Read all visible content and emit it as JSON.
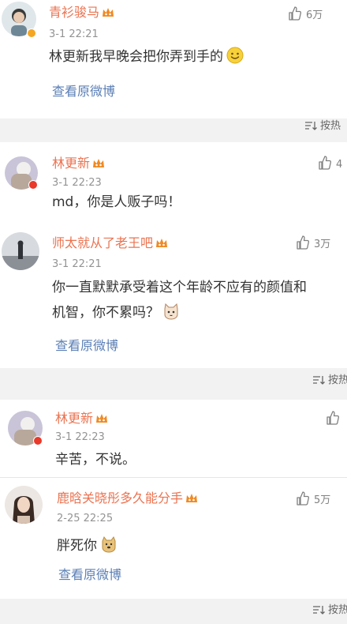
{
  "comments": [
    {
      "name": "青衫骏马",
      "time": "3-1 22:21",
      "likes": "6万",
      "text": "林更新我早晚会把你弄到手的",
      "link": "查看原微博",
      "avatar_icon": "user-avatar-icon",
      "badge_icon": "verified-badge-icon"
    },
    {
      "name": "林更新",
      "time": "3-1 22:23",
      "likes": "4",
      "text": "md，你是人贩子吗！",
      "avatar_icon": "user-avatar-icon",
      "badge_icon": "verified-badge-icon"
    },
    {
      "name": "师太就从了老王吧",
      "time": "3-1 22:21",
      "likes": "3万",
      "text_line1": "你一直默默承受着这个年龄不应有的颜值和",
      "text_line2": "机智，你不累吗？",
      "link": "查看原微博",
      "avatar_icon": "user-avatar-icon"
    },
    {
      "name": "林更新",
      "time": "3-1 22:23",
      "text": "辛苦，不说。",
      "avatar_icon": "user-avatar-icon",
      "badge_icon": "verified-badge-icon"
    },
    {
      "name": "鹿晗关晓彤多久能分手",
      "time": "2-25 22:25",
      "likes": "5万",
      "text": "胖死你",
      "link": "查看原微博",
      "avatar_icon": "user-avatar-icon"
    }
  ],
  "sort_label": "按热",
  "sort_label_2": "按热",
  "sort_label_3": "按热",
  "colors": {
    "name": "#eb7350",
    "link": "#5b7fb5",
    "time": "#939393",
    "text": "#333333",
    "separator": "#f2f2f2"
  }
}
